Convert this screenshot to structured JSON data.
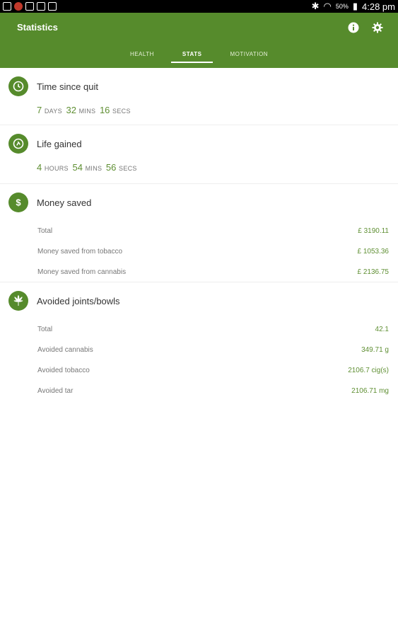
{
  "status_bar": {
    "battery": "50%",
    "time": "4:28 pm"
  },
  "appbar": {
    "title": "Statistics"
  },
  "tabs": [
    {
      "label": "HEALTH"
    },
    {
      "label": "STATS"
    },
    {
      "label": "MOTIVATION"
    }
  ],
  "time_since_quit": {
    "title": "Time since quit",
    "days": "7",
    "days_unit": "DAYS",
    "mins": "32",
    "mins_unit": "MINS",
    "secs": "16",
    "secs_unit": "SECS"
  },
  "life_gained": {
    "title": "Life gained",
    "hours": "4",
    "hours_unit": "HOURS",
    "mins": "54",
    "mins_unit": "MINS",
    "secs": "56",
    "secs_unit": "SECS"
  },
  "money_saved": {
    "title": "Money saved",
    "rows": [
      {
        "label": "Total",
        "value": "£ 3190.11"
      },
      {
        "label": "Money saved from tobacco",
        "value": "£ 1053.36"
      },
      {
        "label": "Money saved from cannabis",
        "value": "£ 2136.75"
      }
    ]
  },
  "avoided": {
    "title": "Avoided joints/bowls",
    "rows": [
      {
        "label": "Total",
        "value": "42.1"
      },
      {
        "label": "Avoided cannabis",
        "value": "349.71 g"
      },
      {
        "label": "Avoided tobacco",
        "value": "2106.7 cig(s)"
      },
      {
        "label": "Avoided tar",
        "value": "2106.71 mg"
      }
    ]
  },
  "colors": {
    "primary": "#568b2c",
    "accent_text": "#5f8f33"
  },
  "icons": [
    "clock-icon",
    "life-icon",
    "dollar-icon",
    "leaf-icon",
    "info-icon",
    "settings-icon"
  ]
}
